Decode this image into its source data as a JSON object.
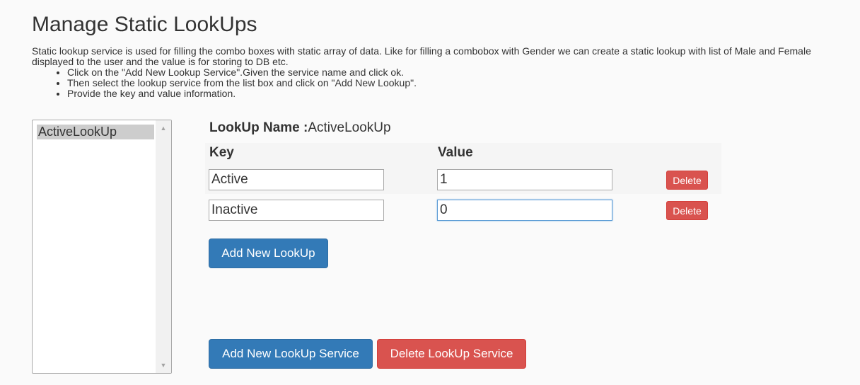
{
  "page": {
    "title": "Manage Static LookUps",
    "description": "Static lookup service is used for filling the combo boxes with static array of data. Like for filling a combobox with Gender we can create a static lookup with list of Male and Female",
    "description_line2": "displayed to the user and the value is for storing to DB etc.",
    "steps": [
      "Click on the \"Add New Lookup Service\".Given the service name and click ok.",
      "Then select the lookup service from the list box and click on \"Add New Lookup\".",
      "Provide the key and value information."
    ]
  },
  "service_list": {
    "items": [
      "ActiveLookUp"
    ],
    "selected": "ActiveLookUp"
  },
  "lookup": {
    "name_label": "LookUp Name :",
    "name_value": "ActiveLookUp",
    "key_header": "Key",
    "value_header": "Value",
    "rows": [
      {
        "key": "Active",
        "value": "1",
        "delete_label": "Delete"
      },
      {
        "key": "Inactive",
        "value": "0",
        "delete_label": "Delete"
      }
    ]
  },
  "buttons": {
    "add_lookup": "Add New LookUp",
    "add_service": "Add New LookUp Service",
    "delete_service": "Delete LookUp Service"
  },
  "colors": {
    "primary": "#337ab7",
    "danger": "#d9534f",
    "background": "#fafafa"
  },
  "icons": {
    "scroll_up": "triangle-up-icon",
    "scroll_down": "triangle-down-icon"
  }
}
